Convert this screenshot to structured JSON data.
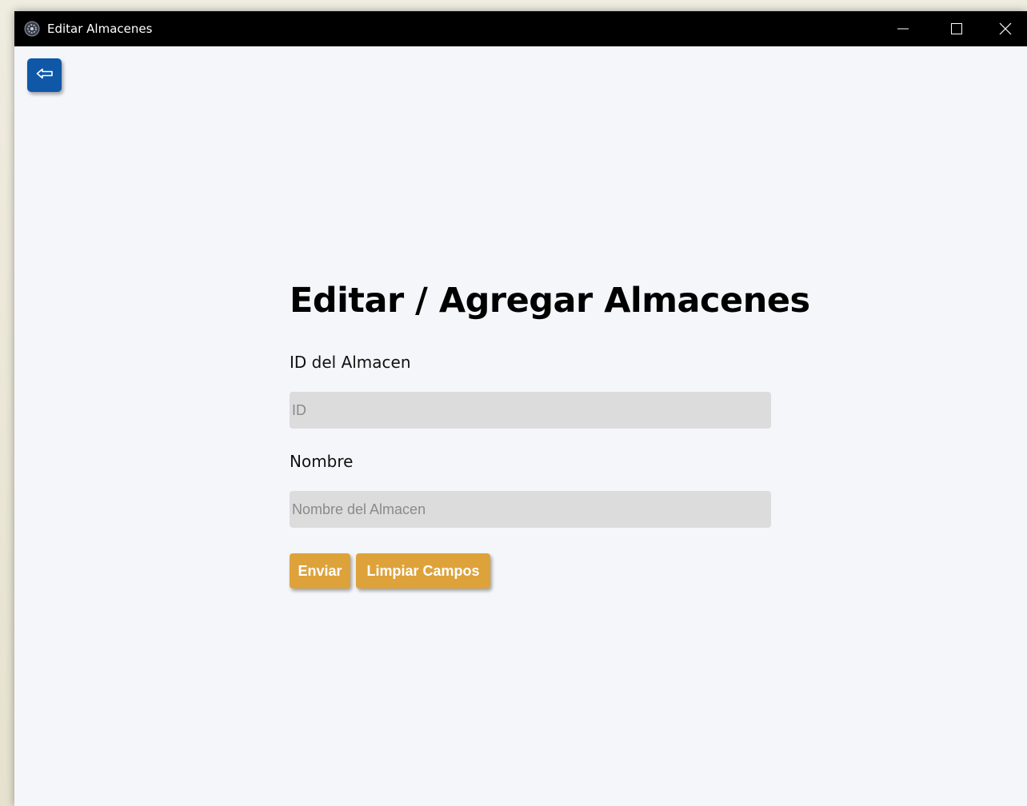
{
  "window": {
    "title": "Editar Almacenes"
  },
  "icons": {
    "app": "app-icon",
    "minimize": "minimize-icon",
    "maximize": "maximize-icon",
    "close": "close-icon",
    "back": "arrow-left-icon"
  },
  "form": {
    "heading": "Editar / Agregar Almacenes",
    "id_label": "ID del Almacen",
    "id_value": "",
    "id_placeholder": "ID",
    "nombre_label": "Nombre",
    "nombre_value": "",
    "nombre_placeholder": "Nombre del Almacen",
    "submit_label": "Enviar",
    "clear_label": "Limpiar Campos"
  },
  "colors": {
    "titlebar": "#000000",
    "background": "#f5f6fa",
    "back_button": "#0f58a8",
    "action_button": "#dea23a",
    "input_background": "#dcdcdc"
  }
}
